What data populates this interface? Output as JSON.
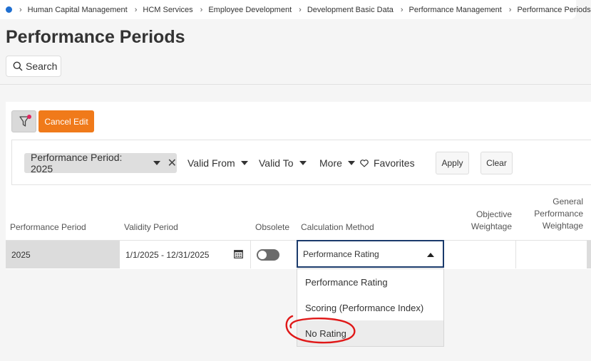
{
  "breadcrumb": {
    "items": [
      "Human Capital Management",
      "HCM Services",
      "Employee Development",
      "Development Basic Data",
      "Performance Management",
      "Performance Periods"
    ]
  },
  "page": {
    "title": "Performance Periods",
    "search_label": "Search"
  },
  "toolbar": {
    "cancel_edit_label": "Cancel Edit"
  },
  "filters": {
    "chip_label": "Performance Period: 2025",
    "valid_from": "Valid From",
    "valid_to": "Valid To",
    "more": "More",
    "favorites": "Favorites",
    "apply": "Apply",
    "clear": "Clear"
  },
  "table": {
    "headers": {
      "period": "Performance Period",
      "validity": "Validity Period",
      "obsolete": "Obsolete",
      "calc": "Calculation Method",
      "objective_line1": "Objective",
      "objective_line2": "Weightage",
      "general_line1": "General",
      "general_line2": "Performance",
      "general_line3": "Weightage"
    },
    "row": {
      "period": "2025",
      "validity": "1/1/2025 - 12/31/2025",
      "obsolete": false,
      "calc": "Performance Rating"
    }
  },
  "dropdown": {
    "options": [
      "Performance Rating",
      "Scoring (Performance Index)",
      "No Rating"
    ],
    "highlighted": "No Rating"
  },
  "colors": {
    "accent": "#f07a1a",
    "focus_border": "#1a3a6b",
    "annotation": "#e01818"
  }
}
